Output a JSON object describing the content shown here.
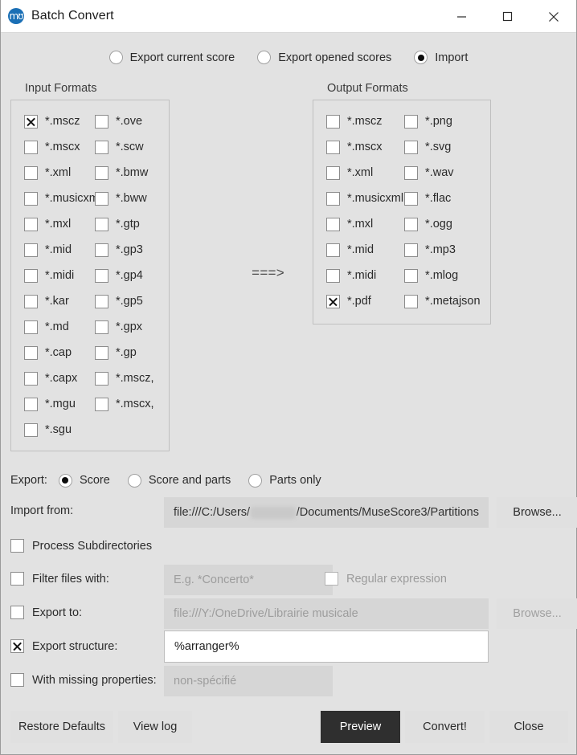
{
  "window": {
    "title": "Batch Convert",
    "icon": "musescore-logo-icon",
    "minimize": "minimize-icon",
    "maximize": "maximize-icon",
    "close": "close-icon",
    "accent_color": "#1a6fb5"
  },
  "mode": {
    "options": [
      {
        "label": "Export current score",
        "checked": false
      },
      {
        "label": "Export opened scores",
        "checked": false
      },
      {
        "label": "Import",
        "checked": true
      }
    ]
  },
  "input_formats": {
    "title": "Input Formats",
    "col1": [
      {
        "label": "*.mscz",
        "checked": true
      },
      {
        "label": "*.mscx",
        "checked": false
      },
      {
        "label": "*.xml",
        "checked": false
      },
      {
        "label": "*.musicxml",
        "checked": false
      },
      {
        "label": "*.mxl",
        "checked": false
      },
      {
        "label": "*.mid",
        "checked": false
      },
      {
        "label": "*.midi",
        "checked": false
      },
      {
        "label": "*.kar",
        "checked": false
      },
      {
        "label": "*.md",
        "checked": false
      },
      {
        "label": "*.cap",
        "checked": false
      },
      {
        "label": "*.capx",
        "checked": false
      },
      {
        "label": "*.mgu",
        "checked": false
      },
      {
        "label": "*.sgu",
        "checked": false
      }
    ],
    "col2": [
      {
        "label": "*.ove",
        "checked": false
      },
      {
        "label": "*.scw",
        "checked": false
      },
      {
        "label": "*.bmw",
        "checked": false
      },
      {
        "label": "*.bww",
        "checked": false
      },
      {
        "label": "*.gtp",
        "checked": false
      },
      {
        "label": "*.gp3",
        "checked": false
      },
      {
        "label": "*.gp4",
        "checked": false
      },
      {
        "label": "*.gp5",
        "checked": false
      },
      {
        "label": "*.gpx",
        "checked": false
      },
      {
        "label": "*.gp",
        "checked": false
      },
      {
        "label": "*.mscz,",
        "checked": false
      },
      {
        "label": "*.mscx,",
        "checked": false
      }
    ]
  },
  "output_formats": {
    "title": "Output Formats",
    "col1": [
      {
        "label": "*.mscz",
        "checked": false
      },
      {
        "label": "*.mscx",
        "checked": false
      },
      {
        "label": "*.xml",
        "checked": false
      },
      {
        "label": "*.musicxml",
        "checked": false
      },
      {
        "label": "*.mxl",
        "checked": false
      },
      {
        "label": "*.mid",
        "checked": false
      },
      {
        "label": "*.midi",
        "checked": false
      },
      {
        "label": "*.pdf",
        "checked": true
      }
    ],
    "col2": [
      {
        "label": "*.png",
        "checked": false
      },
      {
        "label": "*.svg",
        "checked": false
      },
      {
        "label": "*.wav",
        "checked": false
      },
      {
        "label": "*.flac",
        "checked": false
      },
      {
        "label": "*.ogg",
        "checked": false
      },
      {
        "label": "*.mp3",
        "checked": false
      },
      {
        "label": "*.mlog",
        "checked": false
      },
      {
        "label": "*.metajson",
        "checked": false
      }
    ]
  },
  "arrow": "===>",
  "export": {
    "label": "Export:",
    "options": [
      {
        "label": "Score",
        "checked": true
      },
      {
        "label": "Score and parts",
        "checked": false
      },
      {
        "label": "Parts only",
        "checked": false
      }
    ]
  },
  "import_from": {
    "label": "Import from:",
    "value_prefix": "file:///C:/Users/",
    "value_suffix": "/Documents/MuseScore3/Partitions",
    "browse_label": "Browse..."
  },
  "process_subdirectories": {
    "label": "Process Subdirectories",
    "checked": false
  },
  "filter_files": {
    "label": "Filter files with:",
    "checked": false,
    "placeholder": "E.g. *Concerto*",
    "value": "",
    "regex_label": "Regular expression",
    "regex_checked": false
  },
  "export_to": {
    "label": "Export to:",
    "checked": false,
    "placeholder": "file:///Y:/OneDrive/Librairie musicale",
    "value": "",
    "browse_label": "Browse..."
  },
  "export_structure": {
    "label": "Export structure:",
    "checked": true,
    "value": "%arranger%"
  },
  "missing_properties": {
    "label": "With missing properties:",
    "checked": false,
    "placeholder": "non-spécifié",
    "value": ""
  },
  "footer": {
    "restore_defaults": "Restore Defaults",
    "view_log": "View log",
    "preview": "Preview",
    "convert": "Convert!",
    "close": "Close"
  }
}
